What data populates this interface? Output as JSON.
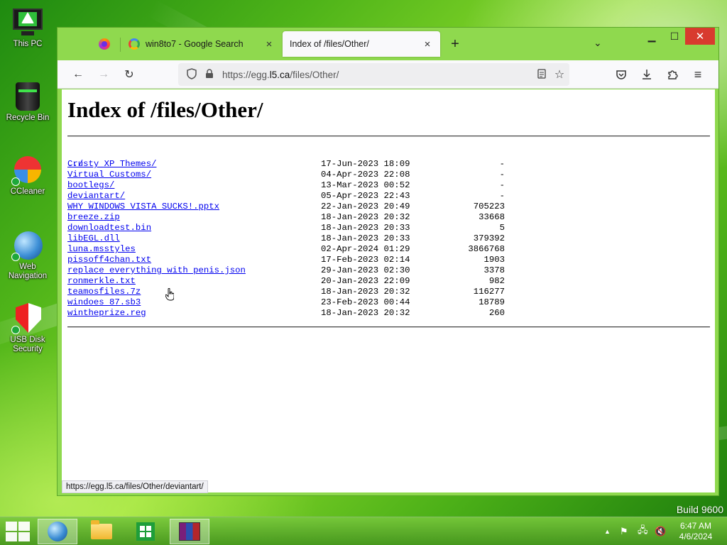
{
  "desktop": {
    "icons": [
      {
        "label": "This PC",
        "icon": "monitor-icon"
      },
      {
        "label": "Recycle Bin",
        "icon": "recycle-bin-icon"
      },
      {
        "label": "CCleaner",
        "icon": "ccleaner-icon"
      },
      {
        "label": "Web Navigation",
        "icon": "globe-icon"
      },
      {
        "label": "USB Disk Security",
        "icon": "shield-icon"
      }
    ],
    "watermark": "Build 9600"
  },
  "browser": {
    "tabs": [
      {
        "label": "",
        "icon": "firefox-icon",
        "pinned": true
      },
      {
        "label": "win8to7 - Google Search",
        "icon": "google-icon",
        "close": "×"
      },
      {
        "label": "Index of /files/Other/",
        "active": true,
        "close": "×"
      }
    ],
    "new_tab": "+",
    "tab_list": "⌄",
    "window_controls": {
      "minimize": "▁",
      "maximize": "☐",
      "close": "✕"
    },
    "nav": {
      "back": "←",
      "forward": "→",
      "reload": "↻"
    },
    "url": {
      "prefix": "https://egg.",
      "host": "l5.ca",
      "path": "/files/Other/"
    },
    "toolbar_icons": [
      "pocket-icon",
      "download-icon",
      "extensions-icon",
      "menu-icon"
    ],
    "status_url": "https://egg.l5.ca/files/Other/deviantart/"
  },
  "page": {
    "title": "Index of /files/Other/",
    "parent": "../",
    "entries": [
      {
        "name": "Crusty XP Themes/",
        "date": "17-Jun-2023 18:09",
        "size": "-"
      },
      {
        "name": "Virtual Customs/",
        "date": "04-Apr-2023 22:08",
        "size": "-"
      },
      {
        "name": "bootlegs/",
        "date": "13-Mar-2023 00:52",
        "size": "-"
      },
      {
        "name": "deviantart/",
        "date": "05-Apr-2023 22:43",
        "size": "-"
      },
      {
        "name": "WHY WINDOWS VISTA SUCKS!.pptx",
        "date": "22-Jan-2023 20:49",
        "size": "705223"
      },
      {
        "name": "breeze.zip",
        "date": "18-Jan-2023 20:32",
        "size": "33668"
      },
      {
        "name": "downloadtest.bin",
        "date": "18-Jan-2023 20:33",
        "size": "5"
      },
      {
        "name": "libEGL.dll",
        "date": "18-Jan-2023 20:33",
        "size": "379392"
      },
      {
        "name": "luna.msstyles",
        "date": "02-Apr-2024 01:29",
        "size": "3866768"
      },
      {
        "name": "pissoff4chan.txt",
        "date": "17-Feb-2023 02:14",
        "size": "1903"
      },
      {
        "name": "replace everything with penis.json",
        "date": "29-Jan-2023 02:30",
        "size": "3378"
      },
      {
        "name": "ronmerkle.txt",
        "date": "20-Jan-2023 22:09",
        "size": "982"
      },
      {
        "name": "teamosfiles.7z",
        "date": "18-Jan-2023 20:32",
        "size": "116277"
      },
      {
        "name": "windoes 87.sb3",
        "date": "23-Feb-2023 00:44",
        "size": "18789"
      },
      {
        "name": "wintheprize.reg",
        "date": "18-Jan-2023 20:32",
        "size": "260"
      }
    ]
  },
  "taskbar": {
    "apps": [
      "internet-explorer-icon",
      "file-explorer-icon",
      "store-icon",
      "winrar-icon"
    ],
    "tray": {
      "chevron": "▲",
      "flag": "⚑",
      "network": "🖧",
      "volume": "🔇"
    },
    "clock": {
      "time": "6:47 AM",
      "date": "4/6/2024"
    }
  }
}
